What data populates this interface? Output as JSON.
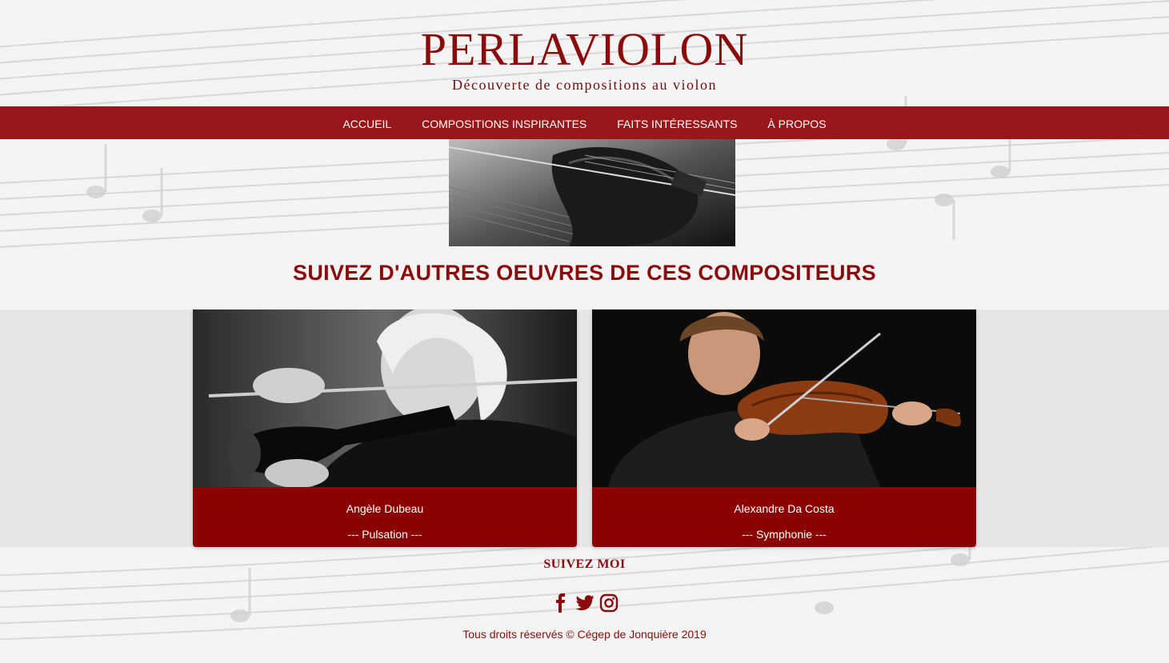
{
  "brand": {
    "title": "PERLAVIOLON",
    "subtitle": "Découverte de compositions au violon"
  },
  "nav": {
    "items": [
      {
        "label": "ACCUEIL"
      },
      {
        "label": "COMPOSITIONS INSPIRANTES"
      },
      {
        "label": "FAITS INTÉRESSANTS"
      },
      {
        "label": "À PROPOS"
      }
    ]
  },
  "section": {
    "title": "SUIVEZ D'AUTRES OEUVRES DE CES COMPOSITEURS"
  },
  "cards": [
    {
      "name": "Angèle Dubeau",
      "work": "--- Pulsation ---"
    },
    {
      "name": "Alexandre Da Costa",
      "work": "--- Symphonie ---"
    }
  ],
  "footer": {
    "follow_label": "SUIVEZ MOI",
    "social": [
      "facebook-icon",
      "twitter-icon",
      "instagram-icon"
    ],
    "copyright": "Tous droits réservés © Cégep de Jonquière 2019"
  },
  "colors": {
    "brand": "#8b0a0a",
    "nav": "#98171a",
    "card": "#8b0000",
    "band": "#e6e6e8"
  }
}
